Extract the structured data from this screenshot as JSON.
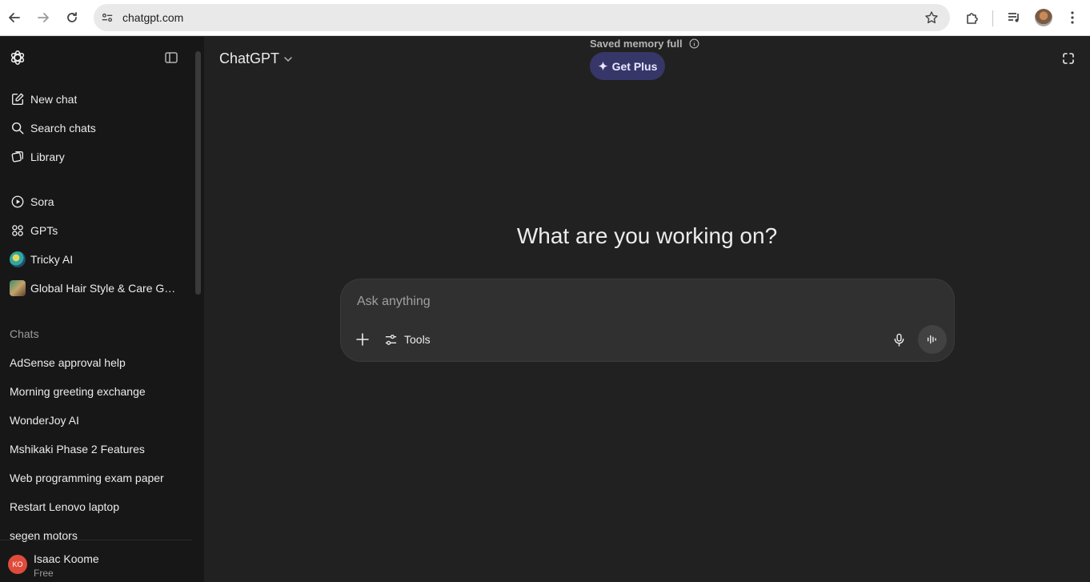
{
  "browser": {
    "url": "chatgpt.com",
    "icons": [
      "back-arrow-icon",
      "forward-arrow-icon",
      "reload-icon",
      "site-settings-icon",
      "bookmark-star-icon",
      "extensions-icon",
      "media-controls-icon",
      "profile-avatar",
      "more-menu-icon"
    ]
  },
  "sidebar": {
    "nav": [
      {
        "label": "New chat",
        "icon": "compose-icon"
      },
      {
        "label": "Search chats",
        "icon": "search-icon"
      },
      {
        "label": "Library",
        "icon": "library-icon"
      }
    ],
    "apps": [
      {
        "label": "Sora",
        "icon": "play-icon"
      },
      {
        "label": "GPTs",
        "icon": "grid-icon"
      },
      {
        "label": "Tricky AI",
        "icon": "gpt-avatar"
      },
      {
        "label": "Global Hair Style & Care Gui...",
        "icon": "gpt-avatar"
      }
    ],
    "chats_label": "Chats",
    "chats": [
      "AdSense approval help",
      "Morning greeting exchange",
      "WonderJoy AI",
      "Mshikaki Phase 2 Features",
      "Web programming exam paper",
      "Restart Lenovo laptop",
      "segen motors"
    ],
    "user": {
      "initials": "KO",
      "name": "Isaac Koome",
      "plan": "Free"
    }
  },
  "main": {
    "model": "ChatGPT",
    "memory_notice": "Saved memory full",
    "get_plus_label": "Get Plus",
    "headline": "What are you working on?",
    "composer": {
      "placeholder": "Ask anything",
      "tools_label": "Tools"
    }
  },
  "colors": {
    "accent_get_plus": "#373669",
    "sidebar_bg": "#171717",
    "main_bg": "#212121",
    "composer_bg": "#303030",
    "user_avatar": "#e04b3b"
  }
}
